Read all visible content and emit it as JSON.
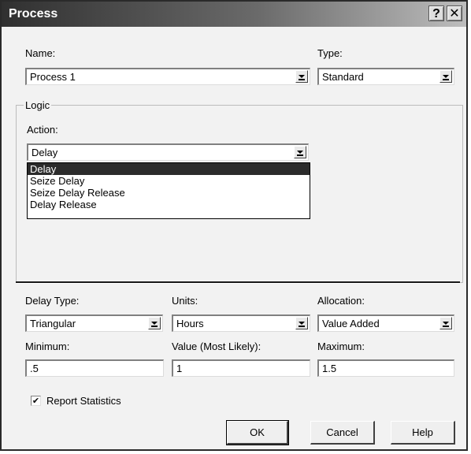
{
  "window": {
    "title": "Process",
    "help_button": "?",
    "close_button": "✕"
  },
  "name": {
    "label": "Name:",
    "value": "Process 1"
  },
  "type": {
    "label": "Type:",
    "value": "Standard"
  },
  "logic": {
    "legend": "Logic",
    "action": {
      "label": "Action:",
      "value": "Delay",
      "options": [
        "Delay",
        "Seize Delay",
        "Seize Delay Release",
        "Delay Release"
      ],
      "selected_index": 0
    }
  },
  "delay_type": {
    "label": "Delay Type:",
    "value": "Triangular"
  },
  "units": {
    "label": "Units:",
    "value": "Hours"
  },
  "allocation": {
    "label": "Allocation:",
    "value": "Value Added"
  },
  "minimum": {
    "label": "Minimum:",
    "value": ".5"
  },
  "most_likely": {
    "label": "Value (Most Likely):",
    "value": "1"
  },
  "maximum": {
    "label": "Maximum:",
    "value": "1.5"
  },
  "report_statistics": {
    "label": "Report Statistics",
    "checked": true,
    "mark": "✔"
  },
  "buttons": {
    "ok": "OK",
    "cancel": "Cancel",
    "help": "Help"
  }
}
